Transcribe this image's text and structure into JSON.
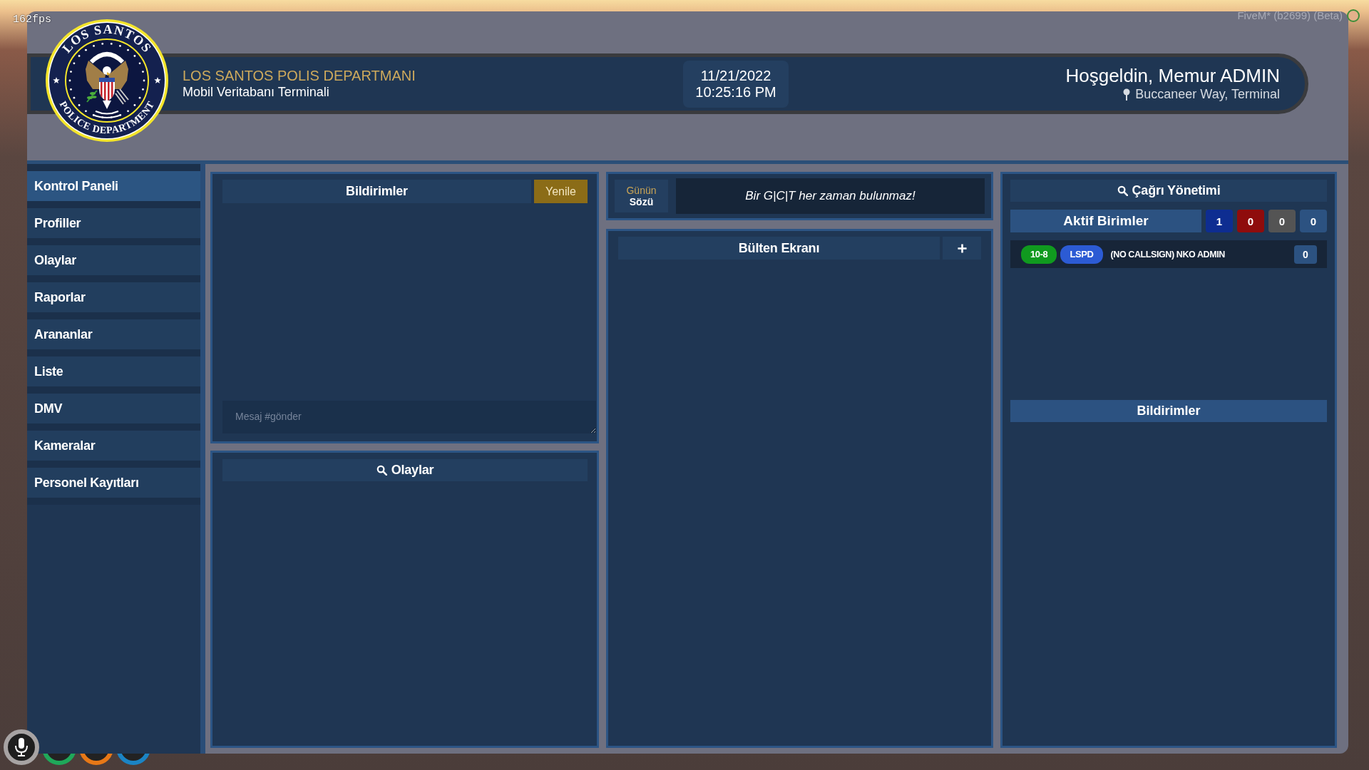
{
  "overlays": {
    "fps": "162fps",
    "client_version": "FiveM* (b2699) (Beta)"
  },
  "header": {
    "logo": {
      "top_text": "LOS SANTOS",
      "bottom_text": "POLICE DEPARTMENT"
    },
    "title": "LOS SANTOS POLIS DEPARTMANI",
    "subtitle": "Mobil Veritabanı Terminali",
    "date": "11/21/2022",
    "time": "10:25:16 PM",
    "greeting": "Hoşgeldin, Memur ADMIN",
    "location": "Buccaneer Way, Terminal"
  },
  "sidebar": {
    "items": [
      {
        "label": "Kontrol Paneli",
        "selected": true
      },
      {
        "label": "Profiller",
        "selected": false
      },
      {
        "label": "Olaylar",
        "selected": false
      },
      {
        "label": "Raporlar",
        "selected": false
      },
      {
        "label": "Arananlar",
        "selected": false
      },
      {
        "label": "Liste",
        "selected": false
      },
      {
        "label": "DMV",
        "selected": false
      },
      {
        "label": "Kameralar",
        "selected": false
      },
      {
        "label": "Personel Kayıtları",
        "selected": false
      }
    ]
  },
  "notifications_panel": {
    "title": "Bildirimler",
    "refresh_button": "Yenile",
    "message_field": {
      "placeholder": "Mesaj #gönder"
    }
  },
  "incidents_panel": {
    "title": "Olaylar"
  },
  "quote_panel": {
    "label_top": "Günün",
    "label_bottom": "Sözü",
    "quote": "Bir G|C|T her zaman bulunmaz!"
  },
  "bulletin_panel": {
    "title": "Bülten Ekranı"
  },
  "dispatch_panel": {
    "title": "Çağrı Yönetimi",
    "active_units": {
      "title": "Aktif Birimler",
      "counts": [
        {
          "value": "1",
          "color": "#0e2d91"
        },
        {
          "value": "0",
          "color": "#8f0c0c"
        },
        {
          "value": "0",
          "color": "#545454"
        },
        {
          "value": "0",
          "color": "#2c5281"
        }
      ]
    },
    "units": [
      {
        "tags": [
          {
            "label": "10-8",
            "color": "#109a1f"
          },
          {
            "label": "LSPD",
            "color": "#2c5bd4"
          }
        ],
        "name": "(NO CALLSIGN) NKO ADMIN",
        "count": "0"
      }
    ],
    "notifications_title": "Bildirimler"
  }
}
